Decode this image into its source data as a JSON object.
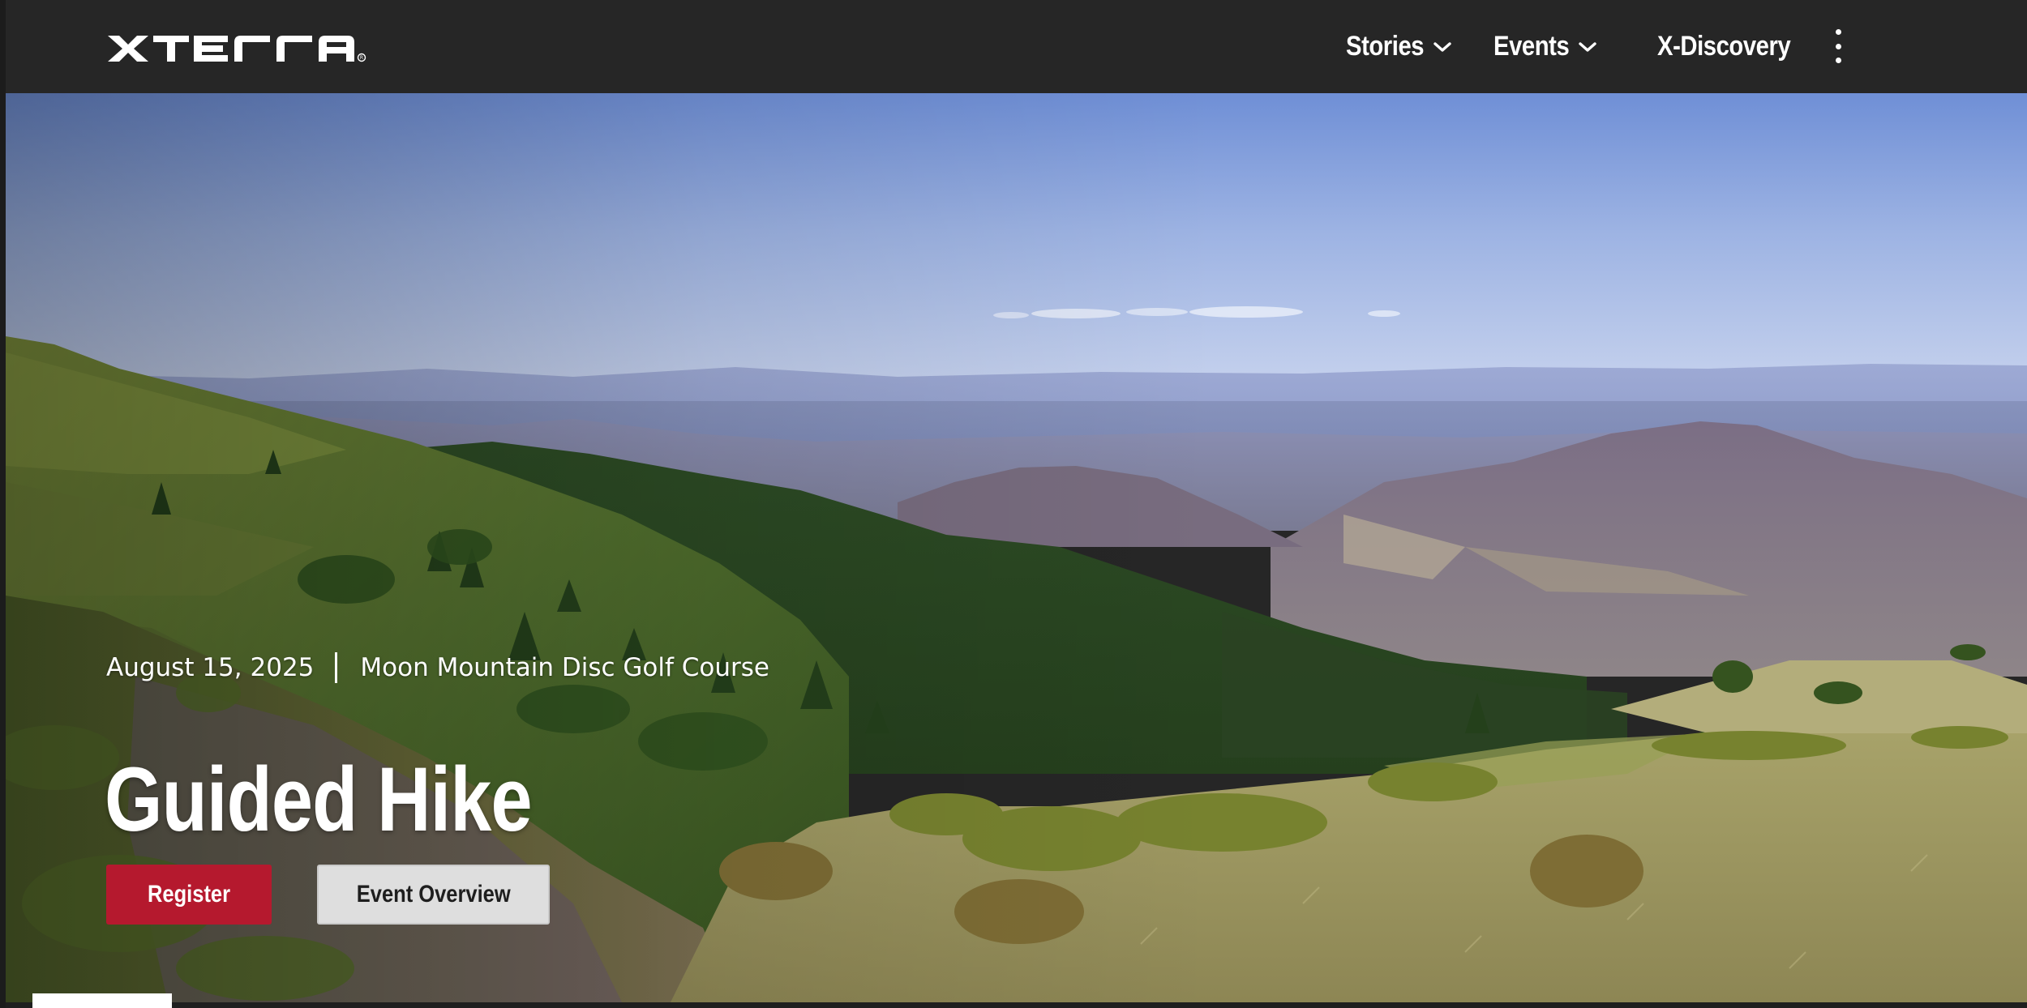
{
  "brand": {
    "logo_text": "XTERRA"
  },
  "nav": {
    "items": [
      {
        "label": "Stories",
        "has_dropdown": true
      },
      {
        "label": "Events",
        "has_dropdown": true
      },
      {
        "label": "X-Discovery",
        "has_dropdown": false
      }
    ],
    "more_icon": "vertical-ellipsis-icon"
  },
  "hero": {
    "date": "August 15, 2025",
    "location": "Moon Mountain Disc Golf Course",
    "title": "Guided Hike",
    "register_label": "Register",
    "overview_label": "Event Overview",
    "image_subject": "mountain-landscape"
  },
  "colors": {
    "nav_background": "#262626",
    "register_button": "#b5192e",
    "overview_button": "#dedede",
    "text_light": "#ffffff"
  }
}
